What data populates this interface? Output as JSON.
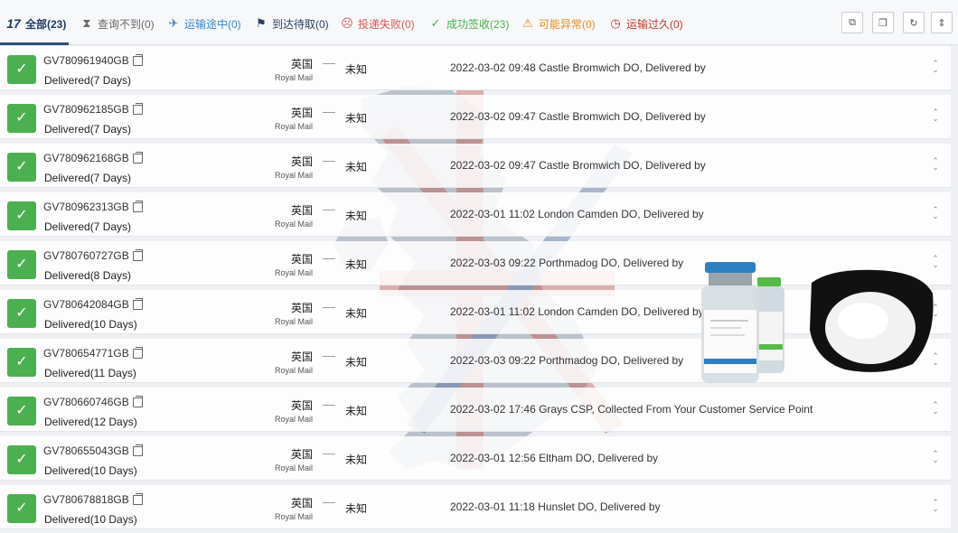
{
  "filters": [
    {
      "icon": "logo-17-icon",
      "label": "全部(23)",
      "color": "#1f3b66"
    },
    {
      "icon": "hourglass-icon",
      "label": "查询不到(0)",
      "color": "#666666"
    },
    {
      "icon": "airplane-icon",
      "label": "运输途中(0)",
      "color": "#3a85c6"
    },
    {
      "icon": "flag-icon",
      "label": "到达待取(0)",
      "color": "#2b3f63"
    },
    {
      "icon": "sad-face-icon",
      "label": "投递失败(0)",
      "color": "#d9534f"
    },
    {
      "icon": "check-icon",
      "label": "成功签收(23)",
      "color": "#4caf50"
    },
    {
      "icon": "warning-icon",
      "label": "可能异常(0)",
      "color": "#e8891e"
    },
    {
      "icon": "clock-icon",
      "label": "运输过久(0)",
      "color": "#c0392b"
    }
  ],
  "shipments": [
    {
      "tracking": "GV780961940GB",
      "status": "Delivered(7 Days)",
      "dest_country": "英国",
      "carrier": "Royal Mail",
      "origin": "未知",
      "event": "2022-03-02 09:48  Castle Bromwich DO, Delivered by"
    },
    {
      "tracking": "GV780962185GB",
      "status": "Delivered(7 Days)",
      "dest_country": "英国",
      "carrier": "Royal Mail",
      "origin": "未知",
      "event": "2022-03-02 09:47  Castle Bromwich DO, Delivered by"
    },
    {
      "tracking": "GV780962168GB",
      "status": "Delivered(7 Days)",
      "dest_country": "英国",
      "carrier": "Royal Mail",
      "origin": "未知",
      "event": "2022-03-02 09:47  Castle Bromwich DO, Delivered by"
    },
    {
      "tracking": "GV780962313GB",
      "status": "Delivered(7 Days)",
      "dest_country": "英国",
      "carrier": "Royal Mail",
      "origin": "未知",
      "event": "2022-03-01 11:02  London Camden DO, Delivered by"
    },
    {
      "tracking": "GV780760727GB",
      "status": "Delivered(8 Days)",
      "dest_country": "英国",
      "carrier": "Royal Mail",
      "origin": "未知",
      "event": "2022-03-03 09:22  Porthmadog DO, Delivered by"
    },
    {
      "tracking": "GV780642084GB",
      "status": "Delivered(10 Days)",
      "dest_country": "英国",
      "carrier": "Royal Mail",
      "origin": "未知",
      "event": "2022-03-01 11:02  London Camden DO, Delivered by"
    },
    {
      "tracking": "GV780654771GB",
      "status": "Delivered(11 Days)",
      "dest_country": "英国",
      "carrier": "Royal Mail",
      "origin": "未知",
      "event": "2022-03-03 09:22  Porthmadog DO, Delivered by"
    },
    {
      "tracking": "GV780660746GB",
      "status": "Delivered(12 Days)",
      "dest_country": "英国",
      "carrier": "Royal Mail",
      "origin": "未知",
      "event": "2022-03-02 17:46  Grays CSP, Collected From Your Customer Service Point"
    },
    {
      "tracking": "GV780655043GB",
      "status": "Delivered(10 Days)",
      "dest_country": "英国",
      "carrier": "Royal Mail",
      "origin": "未知",
      "event": "2022-03-01 12:56  Eltham DO, Delivered by"
    },
    {
      "tracking": "GV780678818GB",
      "status": "Delivered(10 Days)",
      "dest_country": "英国",
      "carrier": "Royal Mail",
      "origin": "未知",
      "event": "2022-03-01 11:18  Hunslet DO, Delivered by"
    }
  ],
  "colors": {
    "success": "#4caf50",
    "active": "#2f4e7e"
  }
}
